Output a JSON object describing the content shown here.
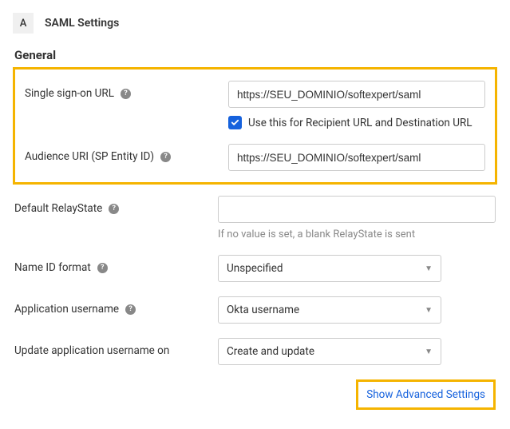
{
  "header": {
    "badge": "A",
    "title": "SAML Settings"
  },
  "section": {
    "title": "General"
  },
  "fields": {
    "sso_url": {
      "label": "Single sign-on URL",
      "value": "https://SEU_DOMINIO/softexpert/saml",
      "checkbox_label": "Use this for Recipient URL and Destination URL"
    },
    "audience_uri": {
      "label": "Audience URI (SP Entity ID)",
      "value": "https://SEU_DOMINIO/softexpert/saml"
    },
    "relay_state": {
      "label": "Default RelayState",
      "value": "",
      "helper": "If no value is set, a blank RelayState is sent"
    },
    "nameid_format": {
      "label": "Name ID format",
      "value": "Unspecified"
    },
    "app_username": {
      "label": "Application username",
      "value": "Okta username"
    },
    "update_on": {
      "label": "Update application username on",
      "value": "Create and update"
    }
  },
  "advanced_link": "Show Advanced Settings"
}
